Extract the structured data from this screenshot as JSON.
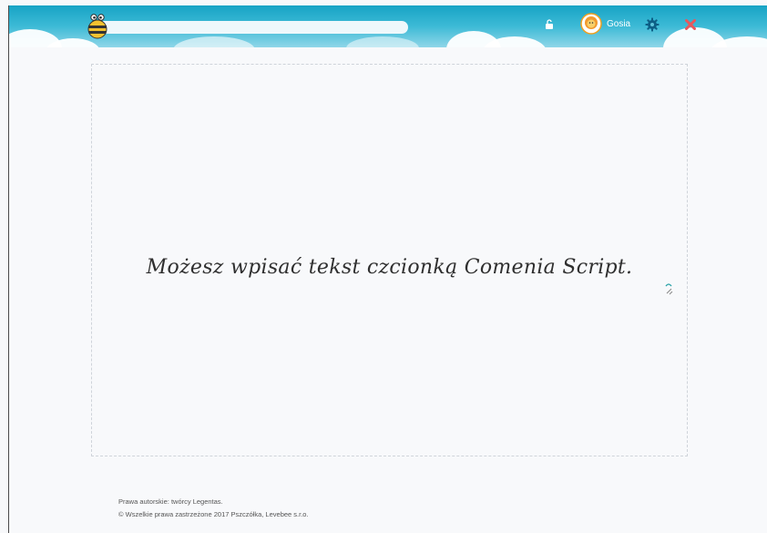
{
  "header": {
    "user": {
      "name": "Gosia",
      "avatar_icon": "lion-avatar-icon"
    },
    "icons": {
      "lock": "unlock-icon",
      "settings": "gear-icon",
      "close": "close-icon"
    },
    "colors": {
      "header": "#1fa7c8",
      "settings": "#0d5f86",
      "close": "#e9575b"
    }
  },
  "editor": {
    "text": "Możesz wpisać tekst czcionką Comenia Script."
  },
  "footer": {
    "line1": "Prawa autorskie: twórcy Legentas.",
    "line2": "© Wszelkie prawa zastrzeżone 2017 Pszczółka, Levebee s.r.o."
  }
}
